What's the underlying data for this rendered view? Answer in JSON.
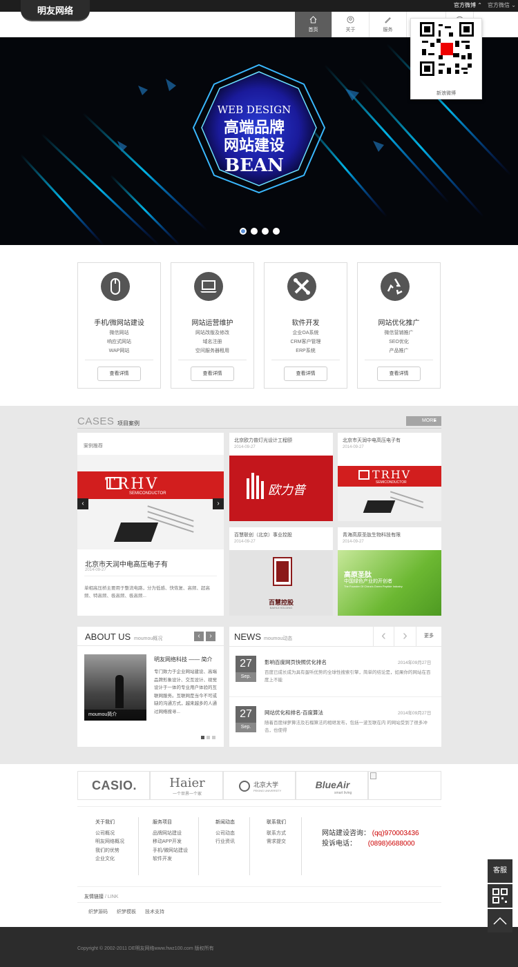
{
  "header": {
    "logo": "明友网络",
    "top_links": [
      "官方微博",
      "官方微信"
    ],
    "nav": [
      {
        "label": "首页",
        "icon": "home-icon"
      },
      {
        "label": "关于",
        "icon": "user-icon"
      },
      {
        "label": "服务",
        "icon": "pen-icon"
      },
      {
        "label": "联系",
        "icon": "chat-icon"
      }
    ],
    "qr_caption": "新浪微博"
  },
  "banner": {
    "line1": "WEB DESIGN",
    "line2": "高端品牌",
    "line3": "网站建设",
    "line4": "BEAN",
    "slides": 4
  },
  "services": [
    {
      "title": "手机/微网站建设",
      "icon": "mouse-icon",
      "items": [
        "微信网站",
        "响应式网站",
        "WAP网站"
      ],
      "button": "查看详情"
    },
    {
      "title": "网站运营维护",
      "icon": "laptop-icon",
      "items": [
        "网站改版及修改",
        "域名注册",
        "空间服务器租用"
      ],
      "button": "查看详情"
    },
    {
      "title": "软件开发",
      "icon": "tools-icon",
      "items": [
        "企业OA系统",
        "CRM客户管理",
        "ERP系统"
      ],
      "button": "查看详情"
    },
    {
      "title": "网站优化推广",
      "icon": "recycle-icon",
      "items": [
        "微信营销推广",
        "SEO优化",
        "产品推广"
      ],
      "button": "查看详情"
    }
  ],
  "cases": {
    "title": "CASES",
    "subtitle": "项目案例",
    "more": "MORE",
    "featured_label": "案例推荐",
    "featured": {
      "title": "北京市天润中电高压电子有",
      "date": "2014-09-27",
      "desc": "单相高压桥主要用于整流电路，分为低感、快恢复、高频、超高频、特高频、极高频、极高频..."
    },
    "items": [
      {
        "title": "北京欧力普灯光设计工程颐",
        "date": "2014-09-27",
        "brand": "欧力普"
      },
      {
        "title": "北京市天润中电高压电子有",
        "date": "2014-09-27",
        "brand": "TRHV"
      },
      {
        "title": "百慧联创（北京）事业控股",
        "date": "2014-09-27",
        "brand": "百慧控股"
      },
      {
        "title": "青海高原圣肽生物科技有限",
        "date": "2014-09-27",
        "brand": "高原圣肽"
      }
    ],
    "trhv": "TRHV",
    "trhv_sub": "SEMICONDUCTOR",
    "bh_sub": "BAIHUI HOLDING",
    "gy_line1": "中国绿色产业的开创者",
    "gy_line2": "The Founder Of China's Green Peptide Industry"
  },
  "about": {
    "title": "ABOUT US",
    "sub": "moumou概况",
    "caption": "moumou简介",
    "heading": "明友网络科技 —— 简介",
    "text": "专门致力于企业网站建设、高端品牌形象设计、交互设计、视觉设计于一体的专业用户体验的互联网服务。互联网是当今不可或缺的沟通方式，越来越多的人通过网络搜寻..."
  },
  "news": {
    "title": "NEWS",
    "sub": "moumou动态",
    "more": "更多",
    "items": [
      {
        "day": "27",
        "mon": "Sep.",
        "title": "影响百度网页快照优化排名",
        "date": "2014年09月27日",
        "desc": "百度已成长成为具有蛋听优势的全球性搜索引擎，简单的结论是，如果你的网站在百度上不能"
      },
      {
        "day": "27",
        "mon": "Sep.",
        "title": "网站优化和排名-百度算法",
        "date": "2014年09月27日",
        "desc": "随着百度绿萝算法及石榴算法的相继发布，包括一波互联在内 的网站受到了很多冲击，也使得"
      }
    ]
  },
  "partners": [
    "CASIO.",
    "Haier",
    "北京大学",
    "BlueAir"
  ],
  "partners_sub": {
    "haier": "一个世界一个家",
    "pku": "PEKING UNIVERSITY",
    "blueair": "smart living"
  },
  "footer": {
    "cols": [
      {
        "head": "关于我们",
        "items": [
          "公司概况",
          "明友网络概况",
          "我们的优势",
          "企业文化"
        ]
      },
      {
        "head": "服务项目",
        "items": [
          "品牌网站建设",
          "移动APP开发",
          "手机/微网站建设",
          "软件开发"
        ]
      },
      {
        "head": "新闻动态",
        "items": [
          "公司动态",
          "行业资讯"
        ]
      },
      {
        "head": "联系我们",
        "items": [
          "联系方式",
          "需求提交"
        ]
      }
    ],
    "consult_label": "网站建设咨询：",
    "consult_value": "(qq)970003436",
    "phone_label": "投诉电话：",
    "phone_value": "(0898)6688000",
    "friend_title": "友情链接",
    "friend_sub": "/ LINK",
    "friend_links": [
      "织梦源码",
      "织梦模板",
      "技术支持"
    ],
    "copyright": "Copyright © 2002-2011 DE明友网络www.hwz100.com 版权所有"
  },
  "side": {
    "service": "客服"
  }
}
